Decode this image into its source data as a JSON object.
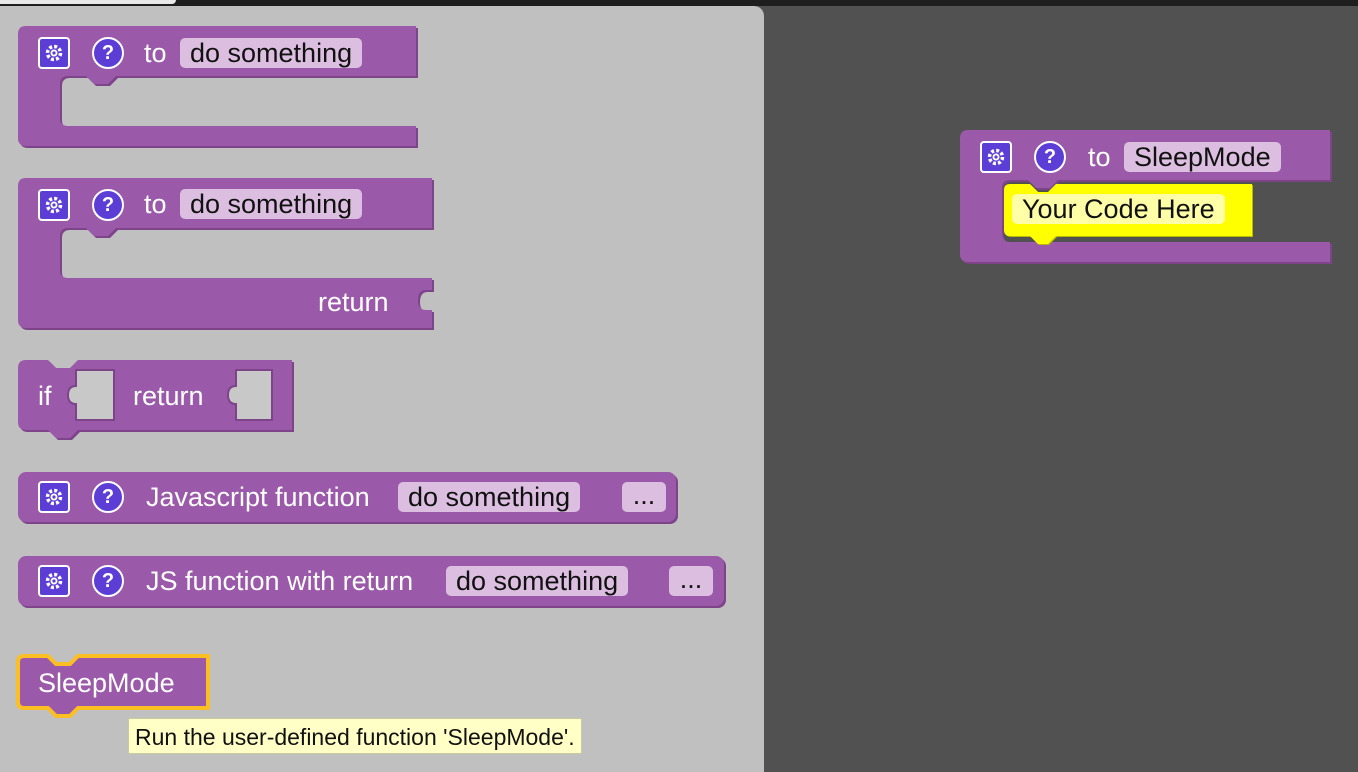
{
  "colors": {
    "block": "#9b59a9",
    "block_shadow": "#7d4489",
    "field": "#dcbfe0",
    "icon": "#5c3ed6",
    "highlight": "#fbbf24",
    "comment_yellow": "#ffff00",
    "workspace": "#515151",
    "flyout": "#c0c0c0"
  },
  "icons": {
    "mutator": "gear-icon",
    "help": "question-icon"
  },
  "flyout": {
    "proc_no_return": {
      "to_label": "to",
      "name": "do something"
    },
    "proc_with_return": {
      "to_label": "to",
      "name": "do something",
      "return_label": "return"
    },
    "if_return": {
      "if_label": "if",
      "return_label": "return"
    },
    "js_function": {
      "label": "Javascript function",
      "name": "do something",
      "dots": "..."
    },
    "js_function_return": {
      "label": "JS function with return",
      "name": "do something",
      "dots": "..."
    },
    "call_block": {
      "name": "SleepMode"
    },
    "tooltip": "Run the user-defined function 'SleepMode'."
  },
  "workspace": {
    "procedure": {
      "to_label": "to",
      "name": "SleepMode",
      "body_placeholder": "Your Code Here"
    }
  }
}
